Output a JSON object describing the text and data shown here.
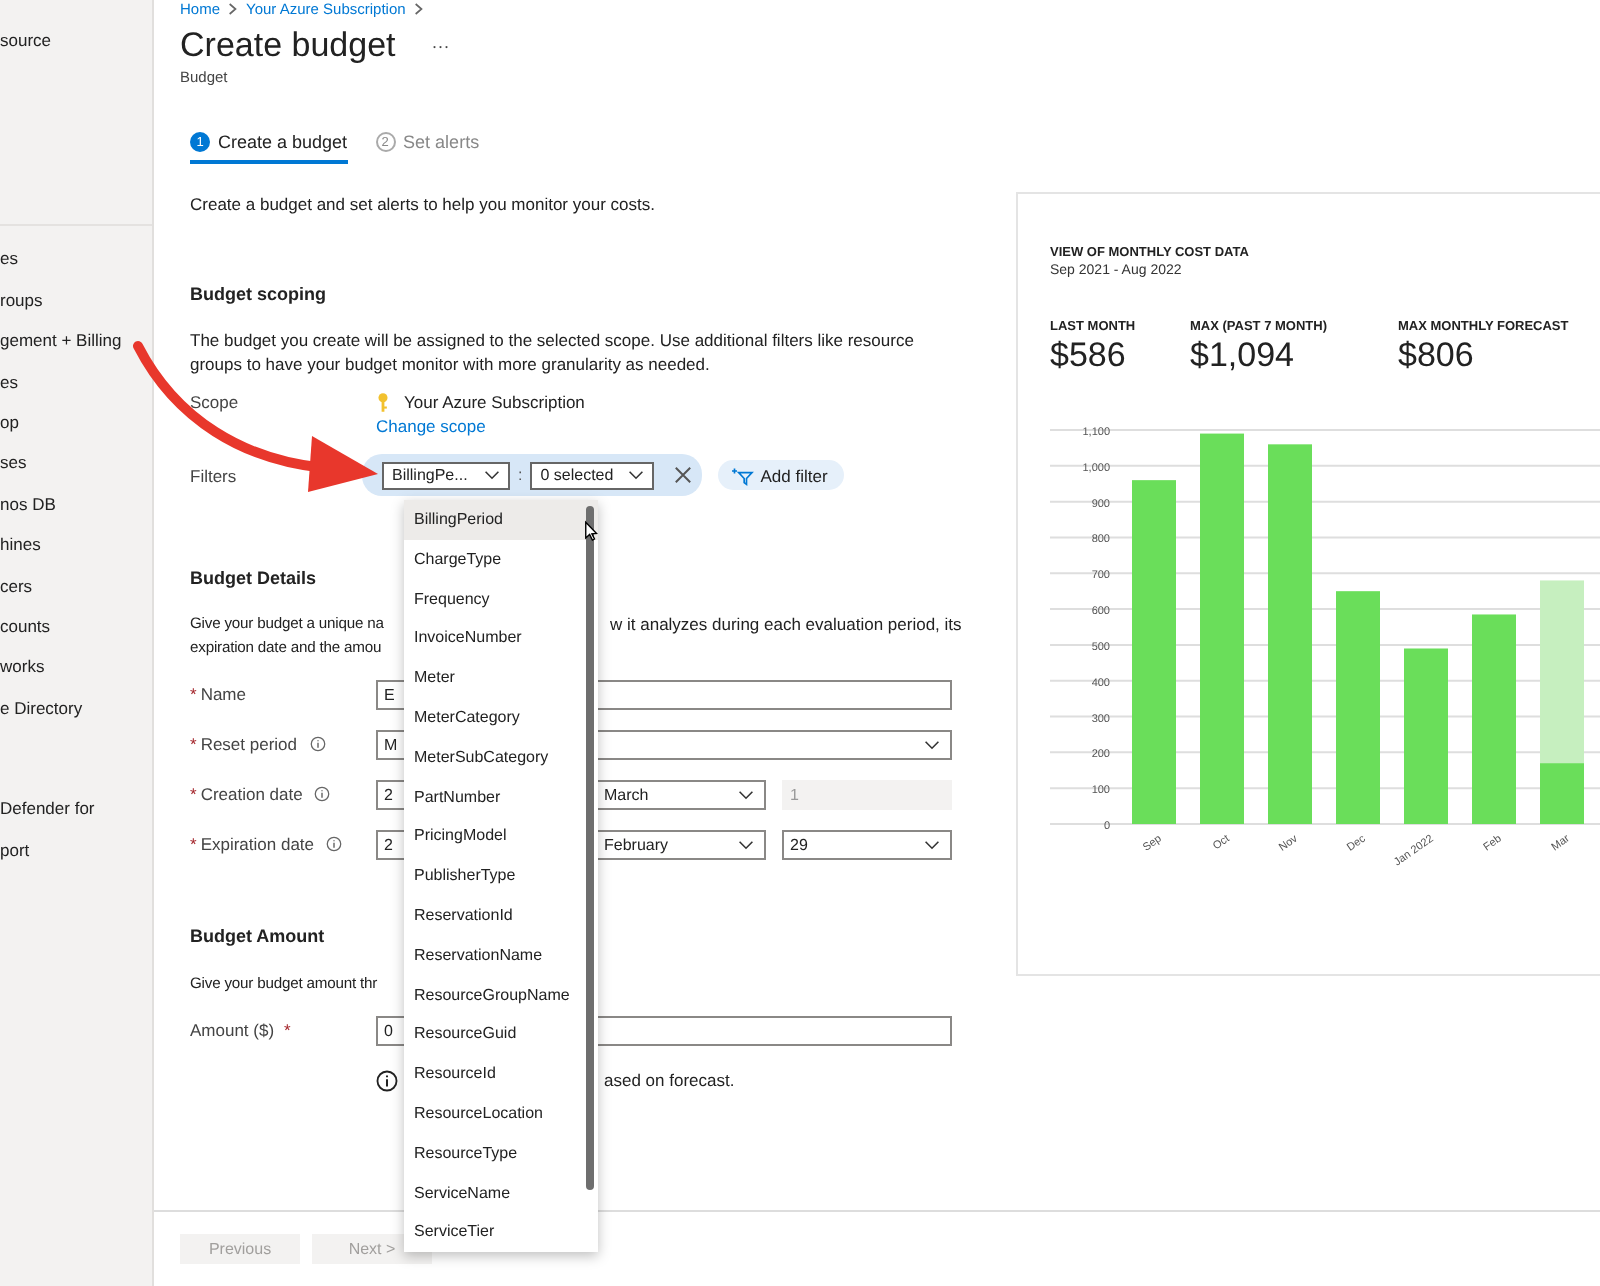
{
  "sidebar": {
    "sections": [
      {
        "items": [
          {
            "label": "source"
          }
        ]
      },
      {
        "items": [
          {
            "label": "es"
          },
          {
            "label": "roups"
          },
          {
            "label": "gement + Billing"
          },
          {
            "label": "es"
          },
          {
            "label": "op"
          },
          {
            "label": "ses"
          },
          {
            "label": "nos DB"
          },
          {
            "label": "hines"
          },
          {
            "label": "cers"
          },
          {
            "label": "counts"
          },
          {
            "label": "works"
          },
          {
            "label": "e Directory"
          }
        ]
      },
      {
        "items": [
          {
            "label": "Defender for"
          },
          {
            "label": "port"
          }
        ]
      }
    ]
  },
  "breadcrumb": [
    "Home",
    "Your Azure Subscription"
  ],
  "page": {
    "title": "Create budget",
    "more": "···",
    "subtitle": "Budget"
  },
  "tabs": [
    {
      "number": "1",
      "label": "Create a budget",
      "selected": true
    },
    {
      "number": "2",
      "label": "Set alerts",
      "selected": false
    }
  ],
  "intro": "Create a budget and set alerts to help you monitor your costs.",
  "scoping": {
    "heading": "Budget scoping",
    "description": "The budget you create will be assigned to the selected scope. Use additional filters like resource groups to have your budget monitor with more granularity as needed.",
    "scope_label": "Scope",
    "scope_value": "Your Azure Subscription",
    "change_scope": "Change scope",
    "filters_label": "Filters",
    "filter_key": "BillingPe...",
    "separator": ":",
    "filter_value": "0 selected",
    "add_filter": "Add filter"
  },
  "details": {
    "heading": "Budget Details",
    "description_left": "Give your budget a unique na",
    "description_right": "w it analyzes during each evaluation period, its",
    "description_line2": "expiration date and the amou",
    "fields": [
      {
        "label": "Name",
        "required_mark": "*",
        "info": false,
        "controls": [
          {
            "kind": "input",
            "value": "E"
          }
        ]
      },
      {
        "label": "Reset period",
        "required_mark": "*",
        "info": true,
        "controls": [
          {
            "kind": "select",
            "value": "M"
          }
        ]
      },
      {
        "label": "Creation date",
        "required_mark": "*",
        "info": true,
        "controls": [
          {
            "kind": "select_short",
            "value": "2"
          },
          {
            "kind": "select",
            "value": "March"
          },
          {
            "kind": "disabled_input",
            "value": "1"
          }
        ]
      },
      {
        "label": "Expiration date",
        "required_mark": "*",
        "info": true,
        "controls": [
          {
            "kind": "select_short",
            "value": "2"
          },
          {
            "kind": "select",
            "value": "February"
          },
          {
            "kind": "select",
            "value": "29"
          }
        ]
      }
    ]
  },
  "amount": {
    "heading": "Budget Amount",
    "description": "Give your budget amount thr",
    "label": "Amount ($)",
    "required_mark": "*",
    "value": "0",
    "hint": "ased on forecast."
  },
  "dropdown": {
    "options": [
      {
        "label": "BillingPeriod",
        "selected": true
      },
      {
        "label": "ChargeType",
        "selected": false
      },
      {
        "label": "Frequency",
        "selected": false
      },
      {
        "label": "InvoiceNumber",
        "selected": false
      },
      {
        "label": "Meter",
        "selected": false
      },
      {
        "label": "MeterCategory",
        "selected": false
      },
      {
        "label": "MeterSubCategory",
        "selected": false
      },
      {
        "label": "PartNumber",
        "selected": false
      },
      {
        "label": "PricingModel",
        "selected": false
      },
      {
        "label": "PublisherType",
        "selected": false
      },
      {
        "label": "ReservationId",
        "selected": false
      },
      {
        "label": "ReservationName",
        "selected": false
      },
      {
        "label": "ResourceGroupName",
        "selected": false
      },
      {
        "label": "ResourceGuid",
        "selected": false
      },
      {
        "label": "ResourceId",
        "selected": false
      },
      {
        "label": "ResourceLocation",
        "selected": false
      },
      {
        "label": "ResourceType",
        "selected": false
      },
      {
        "label": "ServiceName",
        "selected": false
      },
      {
        "label": "ServiceTier",
        "selected": false
      }
    ]
  },
  "chart_panel": {
    "title": "VIEW OF MONTHLY COST DATA",
    "period": "Sep 2021 - Aug 2022",
    "stats": [
      {
        "label": "LAST MONTH",
        "value": "$586"
      },
      {
        "label": "MAX (PAST 7 MONTH)",
        "value": "$1,094"
      },
      {
        "label": "MAX MONTHLY FORECAST",
        "value": "$806"
      }
    ],
    "chart_data": {
      "type": "bar",
      "categories": [
        "Sep",
        "Oct",
        "Nov",
        "Dec",
        "Jan 2022",
        "Feb",
        "Mar"
      ],
      "stacked": true,
      "grid": true,
      "series": [
        {
          "color": "#6ade5a",
          "values": [
            960,
            1090,
            1060,
            650,
            490,
            585,
            170
          ]
        },
        {
          "color": "#c6efbf",
          "values": [
            null,
            null,
            null,
            null,
            null,
            null,
            510
          ]
        }
      ],
      "ylim": [
        0,
        1100
      ],
      "yticks": [
        {
          "value": 0,
          "label": "0"
        },
        {
          "value": 100,
          "label": "100"
        },
        {
          "value": 200,
          "label": "200"
        },
        {
          "value": 300,
          "label": "300"
        },
        {
          "value": 400,
          "label": "400"
        },
        {
          "value": 500,
          "label": "500"
        },
        {
          "value": 600,
          "label": "600"
        },
        {
          "value": 700,
          "label": "700"
        },
        {
          "value": 800,
          "label": "800"
        },
        {
          "value": 900,
          "label": "900"
        },
        {
          "value": 1000,
          "label": "1,000"
        },
        {
          "value": 1100,
          "label": "1,100"
        }
      ]
    }
  },
  "footer": {
    "buttons": [
      {
        "label": "Previous",
        "disabled": true
      },
      {
        "label": "Next >",
        "disabled": true
      }
    ]
  }
}
